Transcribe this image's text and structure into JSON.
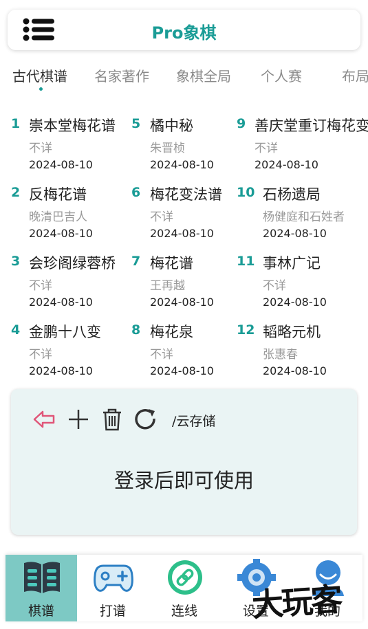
{
  "header": {
    "title": "Pro象棋",
    "menu_icon": "menu-icon"
  },
  "tabs": [
    {
      "label": "古代棋谱",
      "active": true
    },
    {
      "label": "名家著作",
      "active": false
    },
    {
      "label": "象棋全局",
      "active": false
    },
    {
      "label": "个人赛",
      "active": false
    },
    {
      "label": "布局",
      "active": false
    }
  ],
  "books": [
    {
      "num": "1",
      "title": "崇本堂梅花谱",
      "author": "不详",
      "date": "2024-08-10"
    },
    {
      "num": "2",
      "title": "反梅花谱",
      "author": "晚清巴吉人",
      "date": "2024-08-10"
    },
    {
      "num": "3",
      "title": "会珍阁绿蓉桥",
      "author": "不详",
      "date": "2024-08-10"
    },
    {
      "num": "4",
      "title": "金鹏十八变",
      "author": "不详",
      "date": "2024-08-10"
    },
    {
      "num": "5",
      "title": "橘中秘",
      "author": "朱晋桢",
      "date": "2024-08-10"
    },
    {
      "num": "6",
      "title": "梅花变法谱",
      "author": "不详",
      "date": "2024-08-10"
    },
    {
      "num": "7",
      "title": "梅花谱",
      "author": "王再越",
      "date": "2024-08-10"
    },
    {
      "num": "8",
      "title": "梅花泉",
      "author": "不详",
      "date": "2024-08-10"
    },
    {
      "num": "9",
      "title": "善庆堂重订梅花变",
      "author": "不详",
      "date": "2024-08-10"
    },
    {
      "num": "10",
      "title": "石杨遗局",
      "author": "杨健庭和石姓者",
      "date": "2024-08-10"
    },
    {
      "num": "11",
      "title": "事林广记",
      "author": "不详",
      "date": "2024-08-10"
    },
    {
      "num": "12",
      "title": "韬略元机",
      "author": "张惠春",
      "date": "2024-08-10"
    }
  ],
  "cloud": {
    "path": "/云存储",
    "message": "登录后即可使用",
    "tools": [
      "back-arrow-icon",
      "plus-icon",
      "trash-icon",
      "refresh-icon"
    ]
  },
  "nav": [
    {
      "label": "棋谱",
      "icon": "book-icon",
      "active": true
    },
    {
      "label": "打谱",
      "icon": "gamepad-icon",
      "active": false
    },
    {
      "label": "连线",
      "icon": "link-icon",
      "active": false
    },
    {
      "label": "设置",
      "icon": "gear-icon",
      "active": false
    },
    {
      "label": "我的",
      "icon": "user-icon",
      "active": false
    }
  ],
  "watermark": "大玩客",
  "colors": {
    "accent": "#1a9c96",
    "nav_active": "#7dc9c4",
    "cloud_bg": "#eaf4f4",
    "back_arrow": "#e05578"
  }
}
